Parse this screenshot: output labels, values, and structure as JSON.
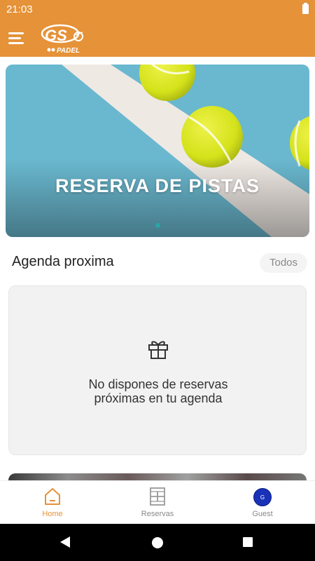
{
  "status_bar": {
    "time": "21:03"
  },
  "app_bar": {
    "logo_text": "PADEL"
  },
  "hero": {
    "title": "RESERVA DE PISTAS"
  },
  "agenda": {
    "title": "Agenda proxima",
    "all_button": "Todos",
    "empty_line1": "No dispones de reservas",
    "empty_line2": "próximas en tu agenda"
  },
  "bottom_nav": {
    "items": [
      {
        "label": "Home",
        "icon": "home-icon",
        "active": true
      },
      {
        "label": "Reservas",
        "icon": "court-icon",
        "active": false
      },
      {
        "label": "Guest",
        "icon": "avatar",
        "avatar_initial": "G",
        "active": false
      }
    ]
  },
  "colors": {
    "primary": "#e59238",
    "court_blue": "#6ab8cf",
    "ball_yellow": "#d8e61e",
    "avatar_blue": "#1a32b8",
    "indicator_teal": "#2aa6a6"
  }
}
